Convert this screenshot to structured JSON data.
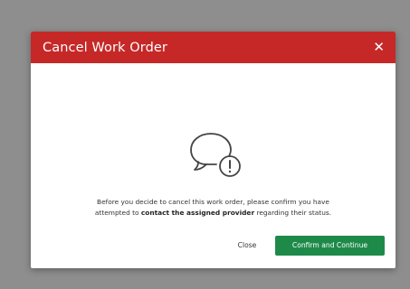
{
  "dialog": {
    "title": "Cancel Work Order",
    "close_icon": "close-icon",
    "header_color": "#c62828",
    "icon": "speech-bubble-exclamation-icon",
    "message_part1": "Before you decide to cancel this work order, please confirm you have",
    "message_part2a": "attempted to ",
    "message_bold": "contact the assigned provider",
    "message_part2b": " regarding their status.",
    "close_button": "Close",
    "confirm_button": "Confirm and Continue",
    "confirm_color": "#1e8a4a"
  }
}
